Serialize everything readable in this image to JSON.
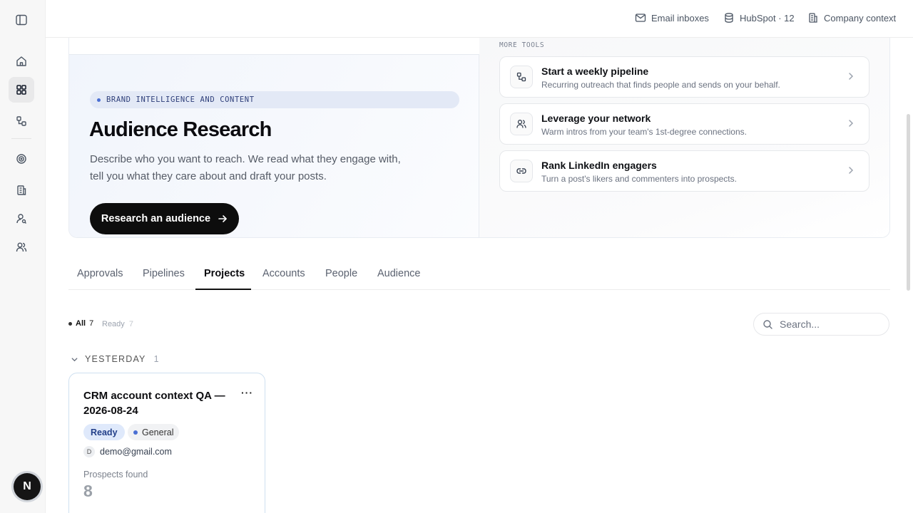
{
  "topbar": {
    "email_inboxes": "Email inboxes",
    "hubspot": "HubSpot · 12",
    "company_context": "Company context"
  },
  "hero": {
    "pill": "BRAND INTELLIGENCE AND CONTENT",
    "title": "Audience Research",
    "description": "Describe who you want to reach. We read what they engage with, tell you what they care about and draft your posts.",
    "cta": "Research an audience"
  },
  "more_tools": {
    "label": "MORE TOOLS",
    "items": [
      {
        "title": "Start a weekly pipeline",
        "desc": "Recurring outreach that finds people and sends on your behalf."
      },
      {
        "title": "Leverage your network",
        "desc": "Warm intros from your team's 1st-degree connections."
      },
      {
        "title": "Rank LinkedIn engagers",
        "desc": "Turn a post's likers and commenters into prospects."
      }
    ]
  },
  "tabs": [
    "Approvals",
    "Pipelines",
    "Projects",
    "Accounts",
    "People",
    "Audience"
  ],
  "active_tab": "Projects",
  "filters": {
    "all_label": "All",
    "all_count": "7",
    "ready_label": "Ready",
    "ready_count": "7"
  },
  "search": {
    "placeholder": "Search..."
  },
  "group": {
    "label": "YESTERDAY",
    "count": "1"
  },
  "project_card": {
    "title": "CRM account context QA — 2026-08-24",
    "status": "Ready",
    "tag": "General",
    "owner_initial": "D",
    "owner_email": "demo@gmail.com",
    "prospects_label": "Prospects found",
    "prospects_value": "8",
    "more_glyph": "···"
  },
  "sidebar": {
    "avatar_initial": "N"
  },
  "colors": {
    "accent": "#4a6fd3",
    "cta_bg": "#0d0d0d",
    "badge_bg": "#dfe9fb"
  }
}
